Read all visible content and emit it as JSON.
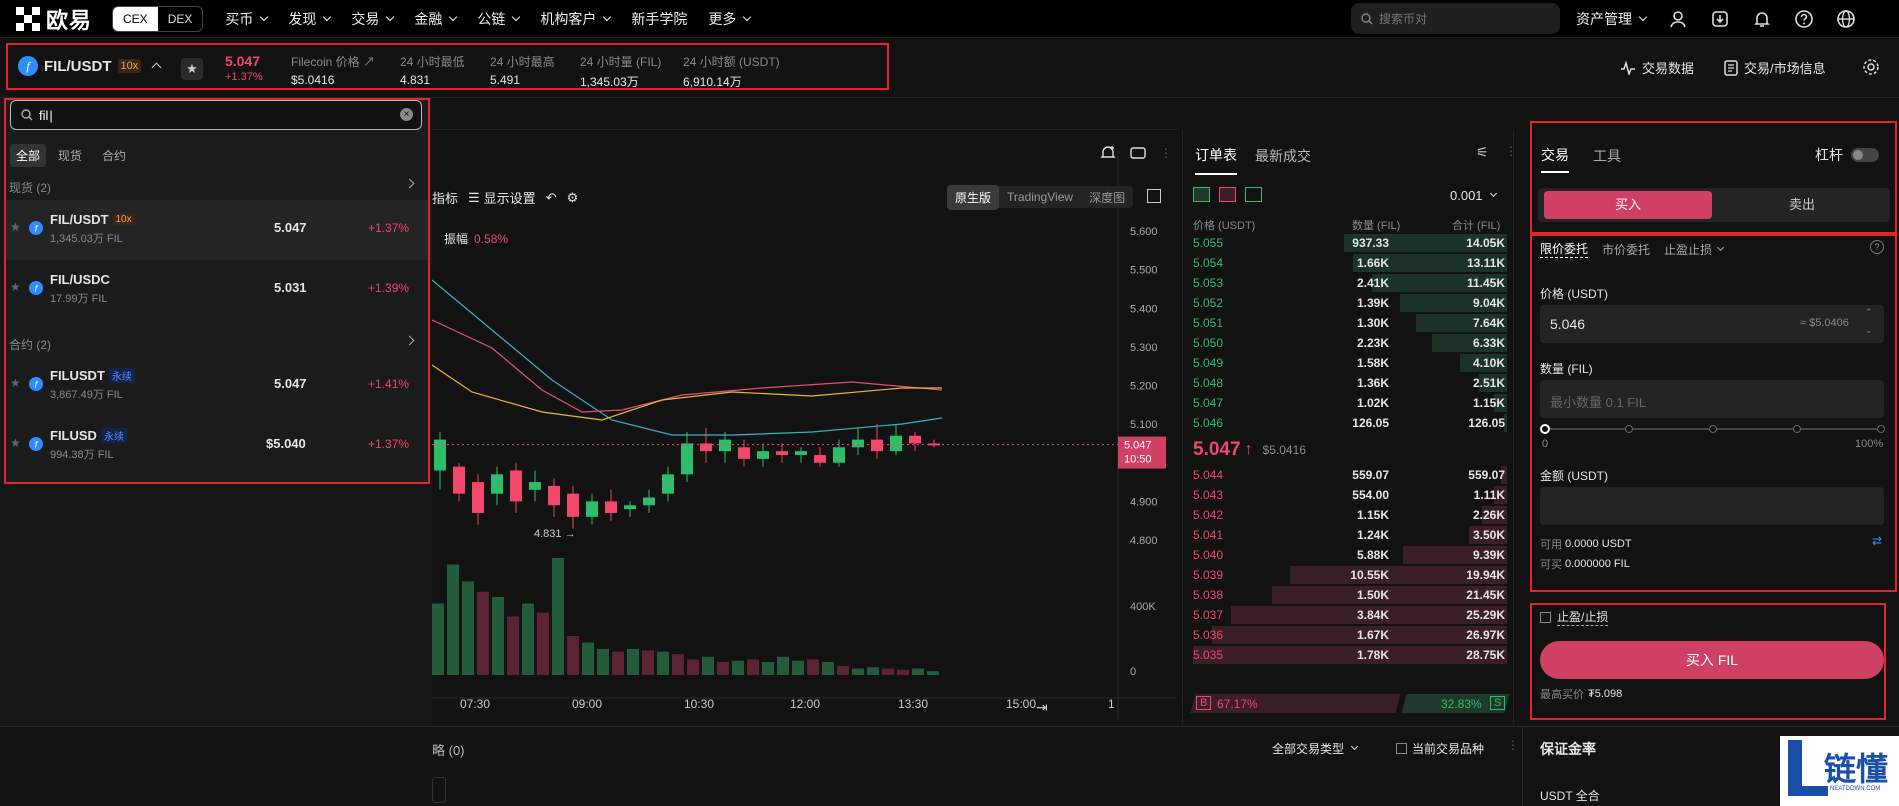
{
  "nav": {
    "logo_text": "欧易",
    "seg": [
      "CEX",
      "DEX"
    ],
    "items": [
      "买币",
      "发现",
      "交易",
      "金融",
      "公链",
      "机构客户",
      "新手学院",
      "更多"
    ],
    "search_placeholder": "搜索币对",
    "asset_mgmt": "资产管理"
  },
  "ticker": {
    "pair": "FIL/USDT",
    "leverage": "10x",
    "price": "5.047",
    "change": "+1.37%",
    "stats": [
      {
        "label": "Filecoin 价格",
        "value": "$5.0416"
      },
      {
        "label": "24 小时最低",
        "value": "4.831"
      },
      {
        "label": "24 小时最高",
        "value": "5.491"
      },
      {
        "label": "24 小时量 (FIL)",
        "value": "1,345.03万"
      },
      {
        "label": "24 小时额 (USDT)",
        "value": "6,910.14万"
      }
    ],
    "right_links": [
      "交易数据",
      "交易/市场信息"
    ]
  },
  "dropdown": {
    "search_value": "fil",
    "tabs": [
      "全部",
      "现货",
      "合约"
    ],
    "spot_header": "现货 (2)",
    "contract_header": "合约 (2)",
    "rows": [
      {
        "name": "FIL/USDT",
        "badge": "10x",
        "volume": "1,345.03万 FIL",
        "price": "5.047",
        "change": "+1.37%"
      },
      {
        "name": "FIL/USDC",
        "badge": "",
        "volume": "17.99万 FIL",
        "price": "5.031",
        "change": "+1.39%"
      },
      {
        "name": "FILUSDT",
        "badge": "永续",
        "volume": "3,867.49万 FIL",
        "price": "5.047",
        "change": "+1.41%"
      },
      {
        "name": "FILUSD",
        "badge": "永续",
        "volume": "994.38万 FIL",
        "price": "$5.040",
        "change": "+1.37%"
      }
    ]
  },
  "chart": {
    "toolbar": [
      "指标",
      "显示设置"
    ],
    "views": [
      "原生版",
      "TradingView",
      "深度图"
    ],
    "amplitude_label": "振幅",
    "amplitude_value": "0.58%",
    "price_axis": [
      "5.600",
      "5.500",
      "5.400",
      "5.300",
      "5.200",
      "5.100",
      "4.900",
      "4.800"
    ],
    "volume_axis": [
      "400K",
      "0"
    ],
    "time_axis": [
      "07:30",
      "09:00",
      "10:30",
      "12:00",
      "13:30",
      "15:00",
      "1"
    ],
    "last_price_tag": "5.047",
    "countdown_tag": "10:50",
    "low_label": "4.831"
  },
  "orderbook": {
    "tabs": [
      "订单表",
      "最新成交"
    ],
    "precision": "0.001",
    "headers": [
      "价格 (USDT)",
      "数量 (FIL)",
      "合计 (FIL)"
    ],
    "bids_top": [
      {
        "p": "5.055",
        "q": "937.33",
        "t": "14.05K",
        "d": 0.52
      },
      {
        "p": "5.054",
        "q": "1.66K",
        "t": "13.11K",
        "d": 0.49
      },
      {
        "p": "5.053",
        "q": "2.41K",
        "t": "11.45K",
        "d": 0.43
      },
      {
        "p": "5.052",
        "q": "1.39K",
        "t": "9.04K",
        "d": 0.34
      },
      {
        "p": "5.051",
        "q": "1.30K",
        "t": "7.64K",
        "d": 0.29
      },
      {
        "p": "5.050",
        "q": "2.23K",
        "t": "6.33K",
        "d": 0.24
      },
      {
        "p": "5.049",
        "q": "1.58K",
        "t": "4.10K",
        "d": 0.15
      },
      {
        "p": "5.048",
        "q": "1.36K",
        "t": "2.51K",
        "d": 0.09
      },
      {
        "p": "5.047",
        "q": "1.02K",
        "t": "1.15K",
        "d": 0.04
      },
      {
        "p": "5.046",
        "q": "126.05",
        "t": "126.05",
        "d": 0.01
      }
    ],
    "mid_price": "5.047",
    "mid_usd": "$5.0416",
    "asks": [
      {
        "p": "5.044",
        "q": "559.07",
        "t": "559.07",
        "d": 0.02
      },
      {
        "p": "5.043",
        "q": "554.00",
        "t": "1.11K",
        "d": 0.04
      },
      {
        "p": "5.042",
        "q": "1.15K",
        "t": "2.26K",
        "d": 0.08
      },
      {
        "p": "5.041",
        "q": "1.24K",
        "t": "3.50K",
        "d": 0.12
      },
      {
        "p": "5.040",
        "q": "5.88K",
        "t": "9.39K",
        "d": 0.33
      },
      {
        "p": "5.039",
        "q": "10.55K",
        "t": "19.94K",
        "d": 0.69
      },
      {
        "p": "5.038",
        "q": "1.50K",
        "t": "21.45K",
        "d": 0.75
      },
      {
        "p": "5.037",
        "q": "3.84K",
        "t": "25.29K",
        "d": 0.88
      },
      {
        "p": "5.036",
        "q": "1.67K",
        "t": "26.97K",
        "d": 0.94
      },
      {
        "p": "5.035",
        "q": "1.78K",
        "t": "28.75K",
        "d": 1.0
      }
    ],
    "ratio_b": "B",
    "ratio_b_val": "67.17%",
    "ratio_s_val": "32.83%",
    "ratio_s": "S",
    "buy_ratio": 0.6717
  },
  "trade": {
    "tabs": [
      "交易",
      "工具"
    ],
    "leverage_label": "杠杆",
    "buy_label": "买入",
    "sell_label": "卖出",
    "order_types": [
      "限价委托",
      "市价委托",
      "止盈止损"
    ],
    "price_label": "价格 (USDT)",
    "price_value": "5.046",
    "price_usd": "≈ $5.0406",
    "qty_label": "数量 (FIL)",
    "qty_placeholder": "最小数量 0.1 FIL",
    "slider_min": "0",
    "slider_max": "100%",
    "amount_label": "金额 (USDT)",
    "avail_label": "可用",
    "avail_value": "0.0000 USDT",
    "canbuy_label": "可买",
    "canbuy_value": "0.000000 FIL",
    "tpsl_label": "止盈/止损",
    "submit_label": "买入 FIL",
    "max_price_label": "最高买价",
    "max_price_value": "₮5.098"
  },
  "bottom": {
    "strategy_tab": "略 (0)",
    "all_types": "全部交易类型",
    "current_pair": "当前交易品种",
    "margin_title": "保证金率",
    "margin_mode": "USDT 全合"
  },
  "watermark": {
    "text": "链懂",
    "sub": "NEATDOWN.COM"
  },
  "colors": {
    "green": "#2ebd6b",
    "red": "#f0476b",
    "buy_button": "#d03f64",
    "highlight_box": "#e0262b"
  }
}
